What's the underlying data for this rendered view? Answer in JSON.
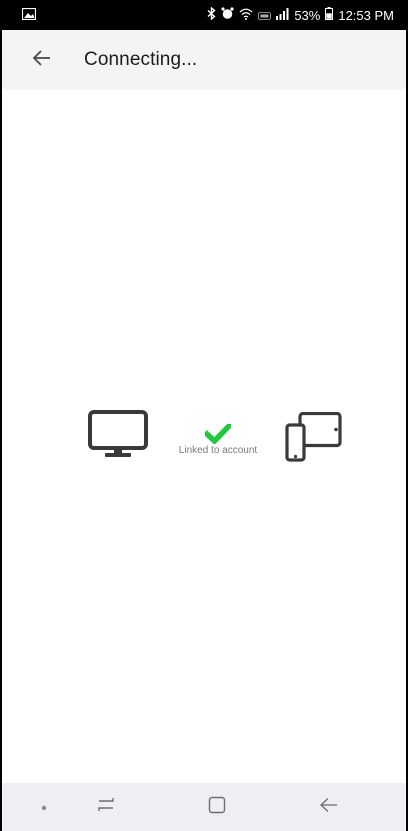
{
  "status_bar": {
    "battery": "53%",
    "time": "12:53 PM",
    "icons": [
      "gallery-icon",
      "bluetooth-icon",
      "alarm-icon",
      "wifi-icon",
      "lte-icon",
      "signal-icon",
      "battery-icon"
    ]
  },
  "app_bar": {
    "title": "Connecting...",
    "back_icon": "arrow-left-icon"
  },
  "connection": {
    "label": "Linked to account",
    "source_icon": "tv-icon",
    "status_icon": "checkmark-icon",
    "target_icon": "phone-tablet-icon",
    "status_color": "#1fc93f"
  },
  "nav_bar": {
    "buttons": [
      "dot-icon",
      "recents-icon",
      "home-icon",
      "back-icon"
    ]
  },
  "colors": {
    "app_bar_bg": "#f4f4f4",
    "nav_bar_bg": "#eeeef3",
    "icon_dark": "#3a3a3a"
  }
}
